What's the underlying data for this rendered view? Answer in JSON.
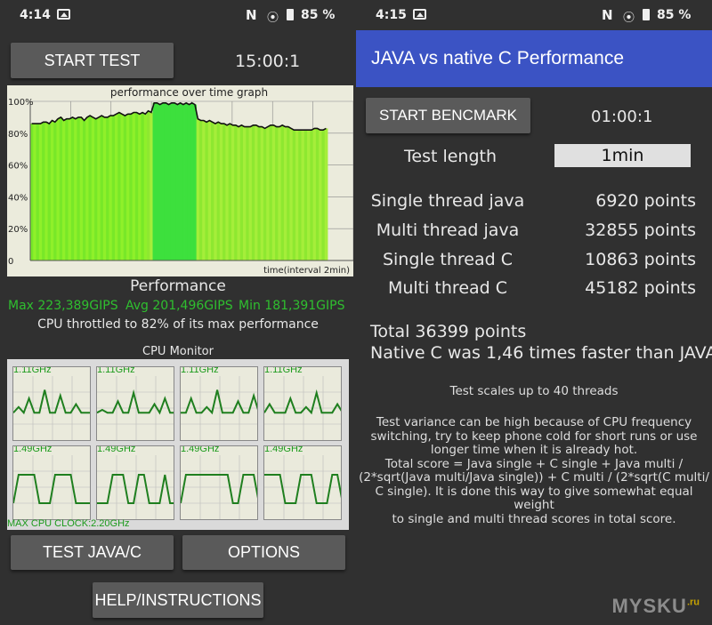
{
  "left": {
    "status": {
      "time": "4:14",
      "battery": "85 %"
    },
    "start_test_label": "START TEST",
    "timer": "15:00:1",
    "graph": {
      "title": "performance over time graph",
      "y_ticks": [
        "100%",
        "80%",
        "60%",
        "40%",
        "20%",
        "0"
      ],
      "x_label": "time(interval 2min)"
    },
    "performance_title": "Performance",
    "max_label": "Max 223,389GIPS",
    "avg_label": "Avg 201,496GIPS",
    "min_label": "Min 181,391GIPS",
    "throttle_text": "CPU throttled to 82% of its max performance",
    "cpu_monitor_title": "CPU Monitor",
    "cores": [
      {
        "freq": "1.11GHz",
        "trace": [
          0.45,
          0.55,
          0.45,
          0.7,
          0.45,
          0.45,
          0.85,
          0.45,
          0.45,
          0.75,
          0.45,
          0.45,
          0.6,
          0.45,
          0.45,
          0.45
        ]
      },
      {
        "freq": "1.11GHz",
        "trace": [
          0.45,
          0.5,
          0.45,
          0.45,
          0.65,
          0.45,
          0.45,
          0.8,
          0.45,
          0.45,
          0.45,
          0.6,
          0.45,
          0.7,
          0.45,
          0.45
        ]
      },
      {
        "freq": "1.11GHz",
        "trace": [
          0.45,
          0.45,
          0.7,
          0.45,
          0.45,
          0.55,
          0.45,
          0.85,
          0.45,
          0.45,
          0.45,
          0.65,
          0.45,
          0.45,
          0.75,
          0.45
        ]
      },
      {
        "freq": "1.11GHz",
        "trace": [
          0.45,
          0.6,
          0.45,
          0.45,
          0.45,
          0.7,
          0.45,
          0.45,
          0.55,
          0.45,
          0.8,
          0.45,
          0.45,
          0.45,
          0.6,
          0.45
        ]
      },
      {
        "freq": "1.49GHz",
        "trace": [
          0.25,
          0.75,
          0.75,
          0.75,
          0.75,
          0.25,
          0.25,
          0.25,
          0.75,
          0.75,
          0.75,
          0.75,
          0.25,
          0.25,
          0.25,
          0.25
        ]
      },
      {
        "freq": "1.49GHz",
        "trace": [
          0.25,
          0.25,
          0.25,
          0.75,
          0.75,
          0.75,
          0.25,
          0.25,
          0.75,
          0.75,
          0.25,
          0.25,
          0.25,
          0.75,
          0.25,
          0.25
        ]
      },
      {
        "freq": "1.49GHz",
        "trace": [
          0.25,
          0.75,
          0.75,
          0.75,
          0.75,
          0.75,
          0.75,
          0.75,
          0.75,
          0.75,
          0.25,
          0.25,
          0.75,
          0.75,
          0.75,
          0.25
        ]
      },
      {
        "freq": "1.49GHz",
        "trace": [
          0.75,
          0.75,
          0.75,
          0.75,
          0.25,
          0.25,
          0.25,
          0.75,
          0.75,
          0.75,
          0.25,
          0.25,
          0.25,
          0.75,
          0.75,
          0.25
        ]
      }
    ],
    "max_cpu_clock": "MAX CPU CLOCK:2.20GHz",
    "test_java_c_label": "TEST JAVA/C",
    "options_label": "OPTIONS",
    "help_label": "HELP/INSTRUCTIONS",
    "colors": {
      "max": "#2fbf2f",
      "avg": "#2fbf2f",
      "min": "#2fbf2f"
    }
  },
  "right": {
    "status": {
      "time": "4:15",
      "battery": "85 %"
    },
    "app_title": "JAVA vs native C Performance",
    "start_benchmark_label": "START BENCMARK",
    "timer": "01:00:1",
    "test_length_label": "Test length",
    "test_length_value": "1min",
    "results": [
      {
        "label": "Single thread java",
        "value": "6920 points"
      },
      {
        "label": "Multi thread java",
        "value": "32855 points"
      },
      {
        "label": "Single thread C",
        "value": "10863 points"
      },
      {
        "label": "Multi thread C",
        "value": "45182 points"
      }
    ],
    "total": "Total 36399 points",
    "native_c_faster": "Native C was 1,46 times faster than JAVA",
    "scales_note": "Test scales up to 40 threads",
    "variance_lines": [
      "Test variance can be high because of CPU frequency",
      "switching, try to keep phone cold for short runs or use",
      "longer time when it is already hot.",
      "Total score = Java single + C single + Java multi /",
      "(2*sqrt(Java multi/Java single)) + C multi / (2*sqrt(C multi/",
      "C single). It is done this way to give somewhat equal weight",
      "to single and multi thread scores in total score."
    ],
    "watermark": "MYSKU",
    "watermark_tld": ".ru",
    "accent_color": "#3b53c4"
  },
  "chart_data": {
    "type": "bar",
    "title": "performance over time graph",
    "xlabel": "time(interval 2min)",
    "ylabel": "",
    "ylim": [
      0,
      100
    ],
    "y_ticks": [
      "100%",
      "80%",
      "60%",
      "40%",
      "20%",
      "0"
    ],
    "values": [
      86,
      86,
      86,
      86,
      87,
      87,
      86,
      88,
      87,
      89,
      90,
      88,
      89,
      89,
      90,
      89,
      90,
      90,
      88,
      90,
      91,
      90,
      89,
      90,
      91,
      90,
      90,
      91,
      91,
      92,
      93,
      92,
      91,
      92,
      92,
      93,
      93,
      92,
      93,
      92,
      94,
      93,
      99,
      99,
      98,
      99,
      99,
      98,
      99,
      99,
      98,
      99,
      98,
      99,
      98,
      99,
      98,
      89,
      88,
      88,
      87,
      88,
      87,
      86,
      87,
      86,
      86,
      85,
      86,
      85,
      85,
      84,
      85,
      84,
      84,
      84,
      85,
      85,
      84,
      84,
      83,
      84,
      85,
      85,
      84,
      84,
      85,
      84,
      84,
      83,
      82,
      82,
      82,
      82,
      82,
      82,
      82,
      83,
      83,
      82,
      82,
      83
    ],
    "series": [
      {
        "values": "see values"
      }
    ]
  }
}
